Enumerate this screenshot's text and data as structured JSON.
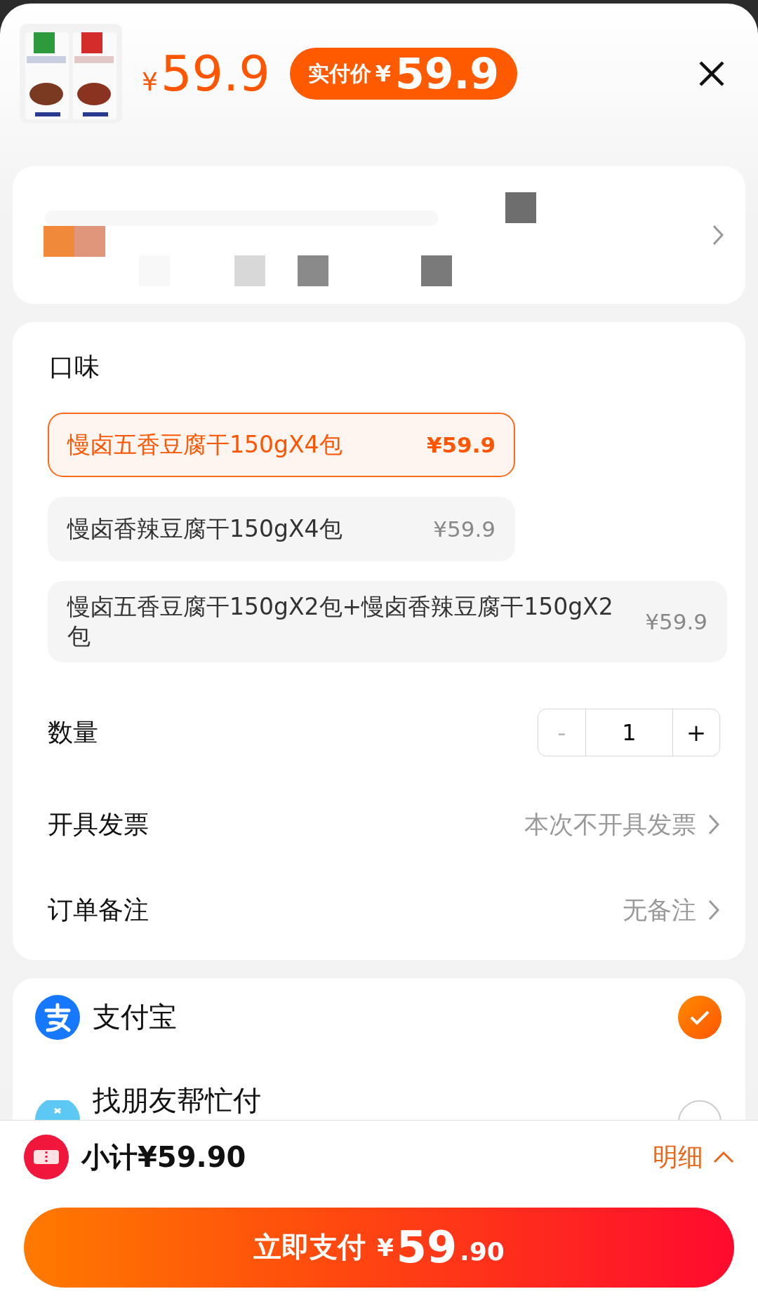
{
  "header": {
    "price": {
      "currency": "¥",
      "amount": "59.9"
    },
    "paid_badge": {
      "label": "实付价",
      "currency": "¥",
      "amount": "59.9"
    }
  },
  "flavor": {
    "title": "口味",
    "options": [
      {
        "name": "慢卤五香豆腐干150gX4包",
        "price": "¥59.9",
        "selected": true
      },
      {
        "name": "慢卤香辣豆腐干150gX4包",
        "price": "¥59.9",
        "selected": false
      },
      {
        "name": "慢卤五香豆腐干150gX2包+慢卤香辣豆腐干150gX2包",
        "price": "¥59.9",
        "selected": false
      }
    ]
  },
  "quantity": {
    "label": "数量",
    "minus": "-",
    "value": "1",
    "plus": "+",
    "minus_disabled": true
  },
  "settings": [
    {
      "label": "开具发票",
      "value": "本次不开具发票"
    },
    {
      "label": "订单备注",
      "value": "无备注"
    }
  ],
  "payments": [
    {
      "kind": "alipay",
      "name": "支付宝",
      "selected": true
    },
    {
      "kind": "friend",
      "name": "找朋友帮忙付",
      "selected": false
    }
  ],
  "subtotal": {
    "label": "小计¥59.90",
    "detail": "明细"
  },
  "pay_button": {
    "label": "立即支付",
    "currency": "¥",
    "integer": "59",
    "decimal": ".90"
  }
}
